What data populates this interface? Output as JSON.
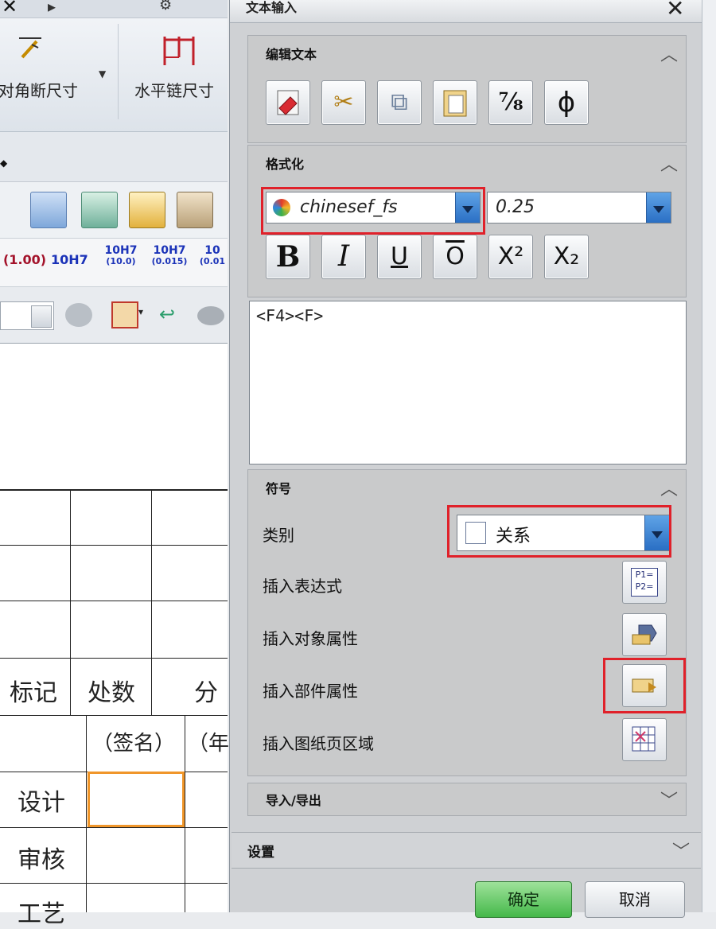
{
  "background_app": {
    "ribbon": {
      "btn1_label": "对角断尺寸",
      "btn2_label": "水平链尺寸"
    },
    "tolerance_buttons": [
      {
        "main": "(1.00)",
        "sub": ""
      },
      {
        "main": "10H7",
        "sub": ""
      },
      {
        "main": "10H7",
        "sub": "(10.0)"
      },
      {
        "main": "10H7",
        "sub": "(0.015)"
      },
      {
        "main": "10",
        "sub": "(0.01"
      }
    ],
    "title_block": {
      "col_mark": "标记",
      "col_count": "处数",
      "col_zone": "分",
      "sign": "（签名）",
      "year": "（年",
      "row_design": "设计",
      "row_check": "审核",
      "row_process": "工艺"
    }
  },
  "dialog": {
    "title": "文本输入",
    "edit_group": {
      "title": "编辑文本",
      "buttons": [
        {
          "name": "clear-text",
          "glyph": ""
        },
        {
          "name": "cut",
          "glyph": "✂"
        },
        {
          "name": "copy",
          "glyph": "⧉"
        },
        {
          "name": "paste",
          "glyph": "📋"
        },
        {
          "name": "remove-format",
          "glyph": "⅞"
        },
        {
          "name": "insert-diameter",
          "glyph": "ϕ"
        }
      ]
    },
    "format_group": {
      "title": "格式化",
      "font": "chinesef_fs",
      "size": "0.25",
      "style_buttons": [
        "B",
        "I",
        "U",
        "O",
        "X²",
        "X₂"
      ]
    },
    "text_area": "<F4><F>",
    "symbol_group": {
      "title": "符号",
      "category_label": "类别",
      "category_value": "关系",
      "rows": [
        "插入表达式",
        "插入对象属性",
        "插入部件属性",
        "插入图纸页区域"
      ]
    },
    "import_export": "导入/导出",
    "settings": "设置",
    "ok": "确定",
    "cancel": "取消"
  }
}
